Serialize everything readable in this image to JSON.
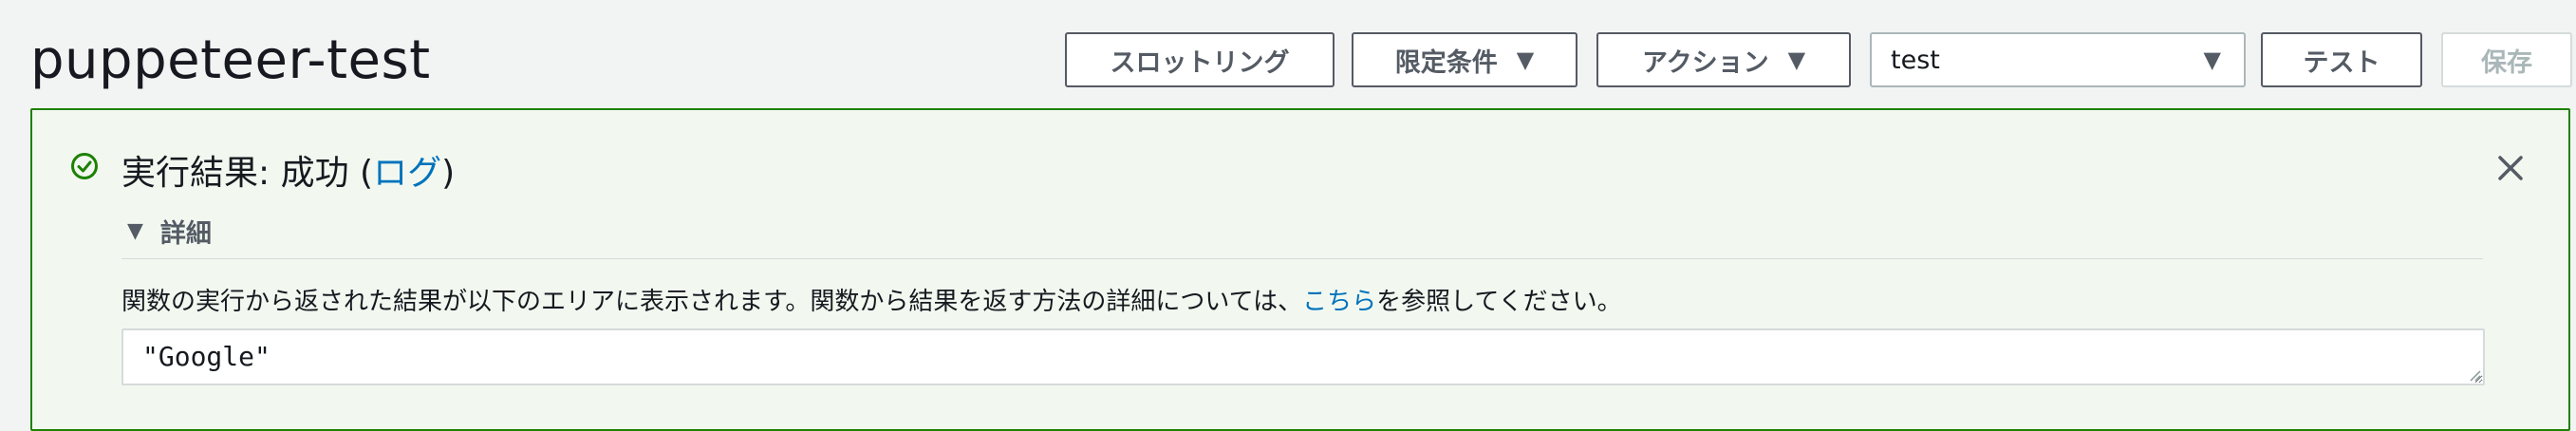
{
  "page": {
    "title": "puppeteer-test"
  },
  "toolbar": {
    "throttling_label": "スロットリング",
    "qualifiers_label": "限定条件",
    "actions_label": "アクション",
    "test_event_selected": "test",
    "test_label": "テスト",
    "save_label": "保存",
    "caret_glyph": "▼"
  },
  "result": {
    "status_prefix": "実行結果: 成功 (",
    "log_link": "ログ",
    "status_suffix": ")",
    "details_toggle": "詳細",
    "details_text_before": "関数の実行から返された結果が以下のエリアに表示されます。関数から結果を返す方法の詳細については、",
    "details_link": "こちら",
    "details_text_after": "を参照してください。",
    "output_value": "\"Google\""
  },
  "icons": {
    "success": "check-circle-icon",
    "close": "close-icon",
    "expand": "triangle-down-icon"
  },
  "colors": {
    "success_border": "#1d8102",
    "panel_background": "#f2f8f0",
    "link": "#0073bb",
    "page_background": "#f2f3f3"
  }
}
